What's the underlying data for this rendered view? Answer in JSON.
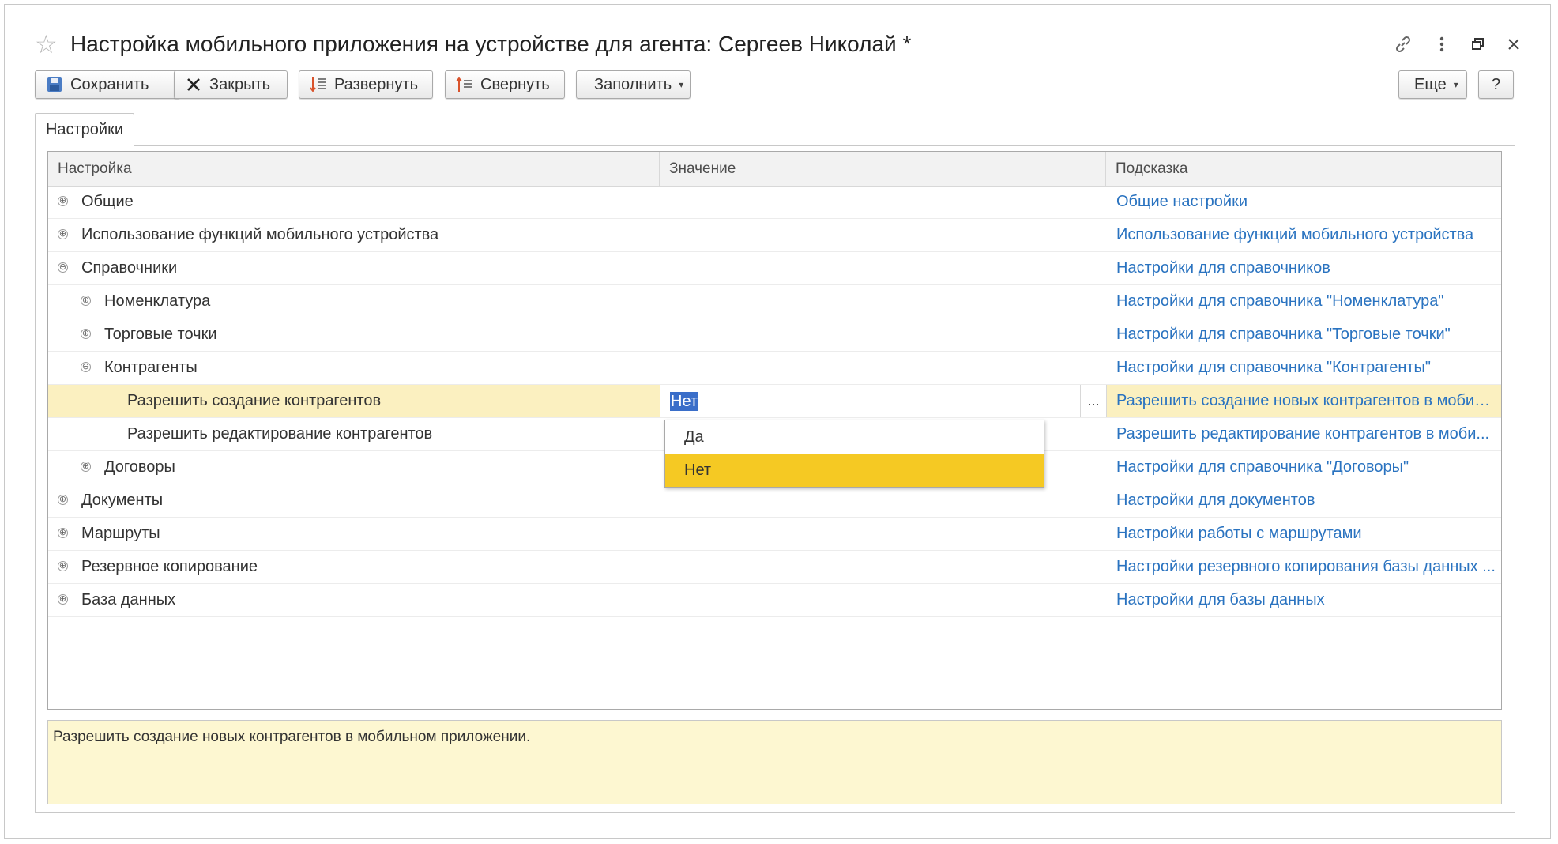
{
  "window": {
    "title": "Настройка мобильного приложения на устройстве для агента: Сергеев Николай *"
  },
  "toolbar": {
    "save": "Сохранить",
    "close": "Закрыть",
    "expand": "Развернуть",
    "collapse": "Свернуть",
    "fill": "Заполнить",
    "more": "Еще",
    "help": "?"
  },
  "tabs": [
    {
      "label": "Настройки"
    }
  ],
  "table": {
    "columns": [
      "Настройка",
      "Значение",
      "Подсказка"
    ],
    "rows": [
      {
        "name": "Общие",
        "expander": "⊕",
        "hint": "Общие настройки"
      },
      {
        "name": "Использование функций мобильного устройства",
        "expander": "⊕",
        "hint": "Использование функций мобильного устройства"
      },
      {
        "name": "Справочники",
        "expander": "⊖",
        "hint": "Настройки для справочников"
      },
      {
        "name": "Номенклатура",
        "expander": "⊕",
        "hint": "Настройки для справочника \"Номенклатура\""
      },
      {
        "name": "Торговые точки",
        "expander": "⊕",
        "hint": "Настройки для справочника \"Торговые точки\""
      },
      {
        "name": "Контрагенты",
        "expander": "⊖",
        "hint": "Настройки для справочника \"Контрагенты\""
      },
      {
        "name": "Разрешить создание контрагентов",
        "value": "Нет",
        "hint": "Разрешить создание новых контрагентов в мобил..."
      },
      {
        "name": "Разрешить редактирование контрагентов",
        "hint": "Разрешить редактирование контрагентов в моби..."
      },
      {
        "name": "Договоры",
        "expander": "⊕",
        "hint": "Настройки для справочника \"Договоры\""
      },
      {
        "name": "Документы",
        "expander": "⊕",
        "hint": "Настройки для документов"
      },
      {
        "name": "Маршруты",
        "expander": "⊕",
        "hint": "Настройки работы с маршрутами"
      },
      {
        "name": "Резервное копирование",
        "expander": "⊕",
        "hint": "Настройки резервного копирования базы данных ..."
      },
      {
        "name": "База данных",
        "expander": "⊕",
        "hint": "Настройки для базы данных"
      }
    ],
    "editor_button": "..."
  },
  "dropdown": {
    "options": [
      "Да",
      "Нет"
    ],
    "highlighted": "Нет"
  },
  "hint_panel": {
    "text": "Разрешить создание новых контрагентов в мобильном приложении."
  },
  "colors": {
    "link": "#2a73c0",
    "selected_row": "#fbf0c0",
    "dropdown_highlight": "#f5c923",
    "hint_panel_bg": "#fdf7d1",
    "value_selection": "#3a6ec9"
  }
}
